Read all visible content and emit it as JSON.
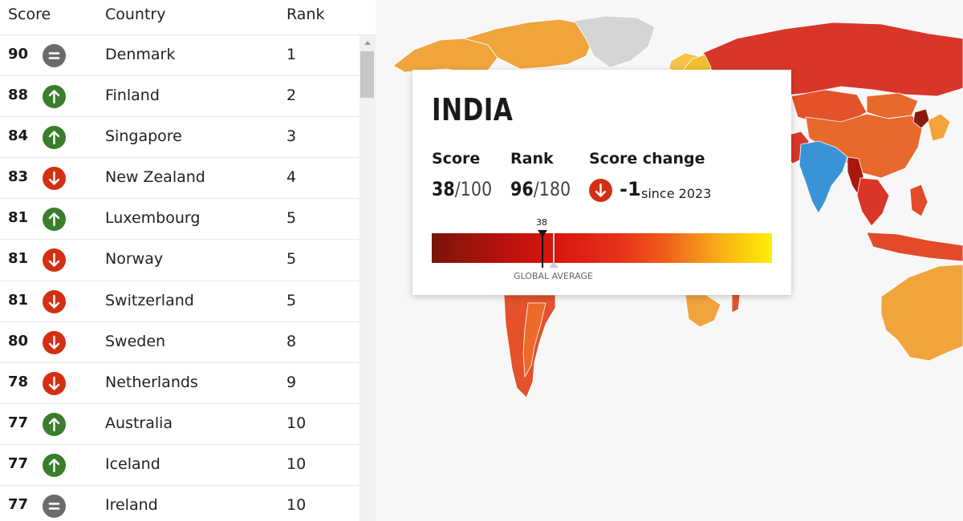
{
  "table": {
    "headers": {
      "score": "Score",
      "country": "Country",
      "rank": "Rank"
    },
    "rows": [
      {
        "score": "90",
        "trend": "equal",
        "country": "Denmark",
        "rank": "1"
      },
      {
        "score": "88",
        "trend": "up",
        "country": "Finland",
        "rank": "2"
      },
      {
        "score": "84",
        "trend": "up",
        "country": "Singapore",
        "rank": "3"
      },
      {
        "score": "83",
        "trend": "down",
        "country": "New Zealand",
        "rank": "4"
      },
      {
        "score": "81",
        "trend": "up",
        "country": "Luxembourg",
        "rank": "5"
      },
      {
        "score": "81",
        "trend": "down",
        "country": "Norway",
        "rank": "5"
      },
      {
        "score": "81",
        "trend": "down",
        "country": "Switzerland",
        "rank": "5"
      },
      {
        "score": "80",
        "trend": "down",
        "country": "Sweden",
        "rank": "8"
      },
      {
        "score": "78",
        "trend": "down",
        "country": "Netherlands",
        "rank": "9"
      },
      {
        "score": "77",
        "trend": "up",
        "country": "Australia",
        "rank": "10"
      },
      {
        "score": "77",
        "trend": "up",
        "country": "Iceland",
        "rank": "10"
      },
      {
        "score": "77",
        "trend": "equal",
        "country": "Ireland",
        "rank": "10"
      }
    ]
  },
  "trend_icons": {
    "up": {
      "icon": "arrow-up-icon",
      "color": "#3a7d2c"
    },
    "down": {
      "icon": "arrow-down-icon",
      "color": "#d32f13"
    },
    "equal": {
      "icon": "equals-icon",
      "color": "#6b6b6b"
    }
  },
  "popup": {
    "country": "INDIA",
    "score_label": "Score",
    "score_value": "38",
    "score_denominator": "/100",
    "rank_label": "Rank",
    "rank_value": "96",
    "rank_denominator": "/180",
    "change_label": "Score change",
    "change_value": "-1",
    "change_since": "since 2023",
    "change_icon": "arrow-down-icon",
    "marker_value": "38",
    "global_average_label": "GLOBAL AVERAGE"
  },
  "map": {
    "highlighted_country_color": "#3a93d6",
    "no_data_color": "#d5d5d5"
  }
}
